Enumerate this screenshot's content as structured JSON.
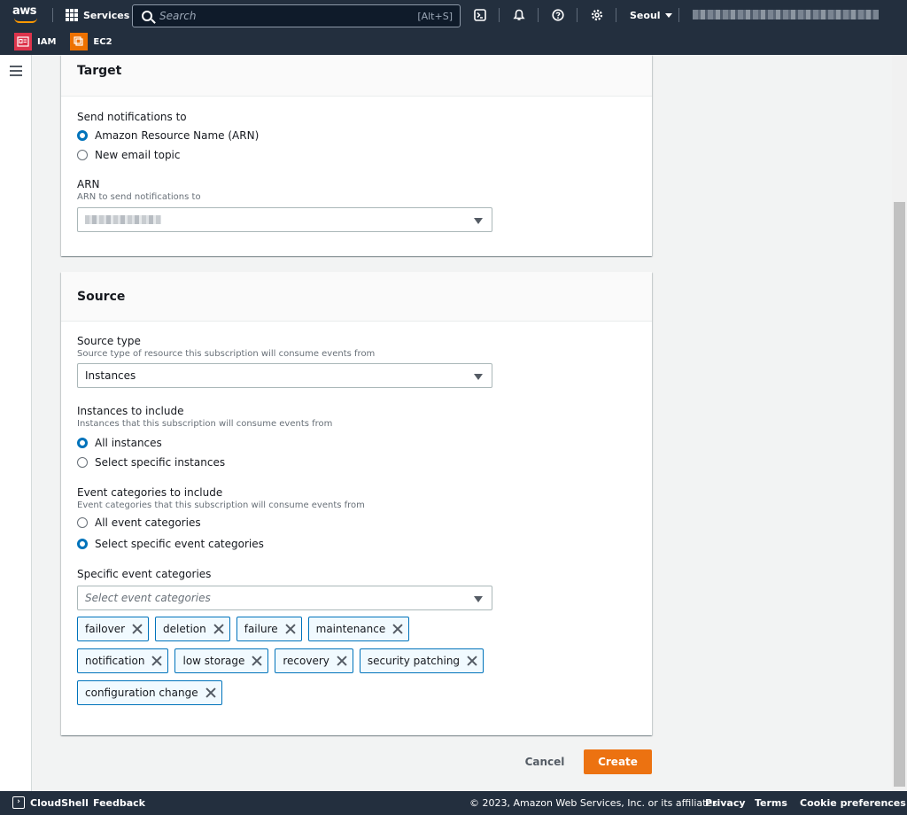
{
  "nav": {
    "logo": "aws",
    "services_label": "Services",
    "search_placeholder": "Search",
    "search_shortcut": "[Alt+S]",
    "region": "Seoul",
    "icons": [
      "cloudshell-icon",
      "bell-icon",
      "help-icon",
      "settings-icon"
    ],
    "favorites": [
      {
        "label": "IAM",
        "icon": "iam-icon",
        "color": "#dd344c"
      },
      {
        "label": "EC2",
        "icon": "ec2-icon",
        "color": "#ed7100"
      }
    ]
  },
  "target": {
    "title": "Target",
    "send_label": "Send notifications to",
    "options": [
      {
        "label": "Amazon Resource Name (ARN)",
        "selected": true
      },
      {
        "label": "New email topic",
        "selected": false
      }
    ],
    "arn_label": "ARN",
    "arn_desc": "ARN to send notifications to"
  },
  "source": {
    "title": "Source",
    "type_label": "Source type",
    "type_desc": "Source type of resource this subscription will consume events from",
    "type_value": "Instances",
    "instances_label": "Instances to include",
    "instances_desc": "Instances that this subscription will consume events from",
    "instances_options": [
      {
        "label": "All instances",
        "selected": true
      },
      {
        "label": "Select specific instances",
        "selected": false
      }
    ],
    "events_label": "Event categories to include",
    "events_desc": "Event categories that this subscription will consume events from",
    "events_options": [
      {
        "label": "All event categories",
        "selected": false
      },
      {
        "label": "Select specific event categories",
        "selected": true
      }
    ],
    "specific_label": "Specific event categories",
    "specific_placeholder": "Select event categories",
    "tokens": [
      "failover",
      "deletion",
      "failure",
      "maintenance",
      "notification",
      "low storage",
      "recovery",
      "security patching",
      "configuration change"
    ]
  },
  "actions": {
    "cancel": "Cancel",
    "create": "Create"
  },
  "footer": {
    "cloudshell": "CloudShell",
    "feedback": "Feedback",
    "copyright": "© 2023, Amazon Web Services, Inc. or its affiliates.",
    "privacy": "Privacy",
    "terms": "Terms",
    "cookies": "Cookie preferences"
  },
  "colors": {
    "nav_bg": "#232f3e",
    "accent_blue": "#0073bb",
    "primary_orange": "#ec7211"
  }
}
